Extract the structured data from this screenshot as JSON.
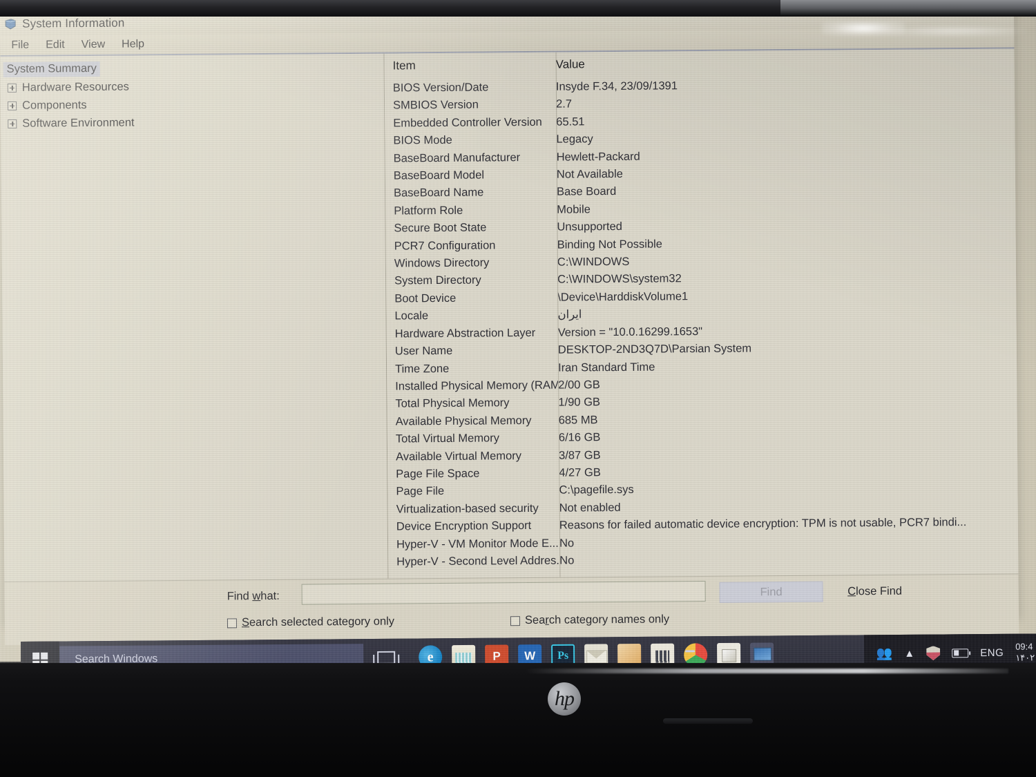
{
  "window": {
    "title": "System Information",
    "icon": "system-information-icon",
    "menu": [
      "File",
      "Edit",
      "View",
      "Help"
    ]
  },
  "tree": {
    "items": [
      {
        "label": "System Summary",
        "expandable": false,
        "selected": true
      },
      {
        "label": "Hardware Resources",
        "expandable": true,
        "selected": false
      },
      {
        "label": "Components",
        "expandable": true,
        "selected": false
      },
      {
        "label": "Software Environment",
        "expandable": true,
        "selected": false
      }
    ]
  },
  "grid": {
    "headers": [
      "Item",
      "Value"
    ],
    "rows": [
      {
        "item": "BIOS Version/Date",
        "value": "Insyde F.34, 23/09/1391",
        "rtl": false
      },
      {
        "item": "SMBIOS Version",
        "value": "2.7",
        "rtl": false
      },
      {
        "item": "Embedded Controller Version",
        "value": "65.51",
        "rtl": false
      },
      {
        "item": "BIOS Mode",
        "value": "Legacy",
        "rtl": false
      },
      {
        "item": "BaseBoard Manufacturer",
        "value": "Hewlett-Packard",
        "rtl": false
      },
      {
        "item": "BaseBoard Model",
        "value": "Not Available",
        "rtl": false
      },
      {
        "item": "BaseBoard Name",
        "value": "Base Board",
        "rtl": false
      },
      {
        "item": "Platform Role",
        "value": "Mobile",
        "rtl": false
      },
      {
        "item": "Secure Boot State",
        "value": "Unsupported",
        "rtl": false
      },
      {
        "item": "PCR7 Configuration",
        "value": "Binding Not Possible",
        "rtl": false
      },
      {
        "item": "Windows Directory",
        "value": "C:\\WINDOWS",
        "rtl": false
      },
      {
        "item": "System Directory",
        "value": "C:\\WINDOWS\\system32",
        "rtl": false
      },
      {
        "item": "Boot Device",
        "value": "\\Device\\HarddiskVolume1",
        "rtl": false
      },
      {
        "item": "Locale",
        "value": "ایران",
        "rtl": true
      },
      {
        "item": "Hardware Abstraction Layer",
        "value": "Version = \"10.0.16299.1653\"",
        "rtl": false
      },
      {
        "item": "User Name",
        "value": "DESKTOP-2ND3Q7D\\Parsian System",
        "rtl": false
      },
      {
        "item": "Time Zone",
        "value": "Iran Standard Time",
        "rtl": false
      },
      {
        "item": "Installed Physical Memory (RAM)",
        "value": "2/00 GB",
        "rtl": false
      },
      {
        "item": "Total Physical Memory",
        "value": "1/90 GB",
        "rtl": false
      },
      {
        "item": "Available Physical Memory",
        "value": "685 MB",
        "rtl": false
      },
      {
        "item": "Total Virtual Memory",
        "value": "6/16 GB",
        "rtl": false
      },
      {
        "item": "Available Virtual Memory",
        "value": "3/87 GB",
        "rtl": false
      },
      {
        "item": "Page File Space",
        "value": "4/27 GB",
        "rtl": false
      },
      {
        "item": "Page File",
        "value": "C:\\pagefile.sys",
        "rtl": false
      },
      {
        "item": "Virtualization-based security",
        "value": "Not enabled",
        "rtl": false
      },
      {
        "item": "Device Encryption Support",
        "value": "Reasons for failed automatic device encryption: TPM is not usable, PCR7 bindi...",
        "rtl": false
      },
      {
        "item": "Hyper-V - VM Monitor Mode E...",
        "value": "No",
        "rtl": false
      },
      {
        "item": "Hyper-V - Second Level Addres...",
        "value": "No",
        "rtl": false
      }
    ]
  },
  "find": {
    "label_pre": "Find ",
    "label_accel": "w",
    "label_post": "hat:",
    "input_value": "",
    "input_placeholder": "",
    "find_button": "Find",
    "close_button_pre": "",
    "close_button_accel": "C",
    "close_button_post": "lose Find",
    "checkbox_selected_pre": "",
    "checkbox_selected_accel": "S",
    "checkbox_selected_post": "earch selected category only",
    "checkbox_names_pre": "Sea",
    "checkbox_names_accel": "r",
    "checkbox_names_post": "ch category names only"
  },
  "taskbar": {
    "search_placeholder": "Search Windows",
    "start_icon": "windows-logo-icon",
    "taskview_icon": "task-view-icon",
    "apps": [
      {
        "name": "edge-icon",
        "label": "e",
        "cls": "ico-edge",
        "running": false,
        "active": false
      },
      {
        "name": "file-explorer-icon",
        "label": "",
        "cls": "ico-explorer",
        "running": false,
        "active": false
      },
      {
        "name": "powerpoint-icon",
        "label": "P",
        "cls": "ico-ppt",
        "running": false,
        "active": false
      },
      {
        "name": "word-icon",
        "label": "W",
        "cls": "ico-word",
        "running": false,
        "active": false
      },
      {
        "name": "photoshop-icon",
        "label": "Ps",
        "cls": "ico-ps",
        "running": false,
        "active": false
      },
      {
        "name": "mail-icon",
        "label": "",
        "cls": "ico-mail",
        "running": false,
        "active": false
      },
      {
        "name": "photos-icon",
        "label": "",
        "cls": "ico-photos",
        "running": false,
        "active": false
      },
      {
        "name": "microsoft-store-icon",
        "label": "",
        "cls": "ico-store",
        "running": false,
        "active": false
      },
      {
        "name": "chrome-icon",
        "label": "",
        "cls": "ico-chrome",
        "running": true,
        "active": false
      },
      {
        "name": "print-3d-icon",
        "label": "",
        "cls": "ico-3d",
        "running": true,
        "active": false
      },
      {
        "name": "system-information-taskbar-icon",
        "label": "",
        "cls": "ico-sysinfo",
        "running": true,
        "active": true
      }
    ],
    "tray": {
      "people_icon": "people-icon",
      "chevron_icon": "chevron-up-icon",
      "security_icon": "security-shield-icon",
      "battery_icon": "battery-icon",
      "language": "ENG",
      "time": "09:4",
      "date": "۱۴۰۲"
    }
  },
  "hardware": {
    "brand": "hp"
  }
}
